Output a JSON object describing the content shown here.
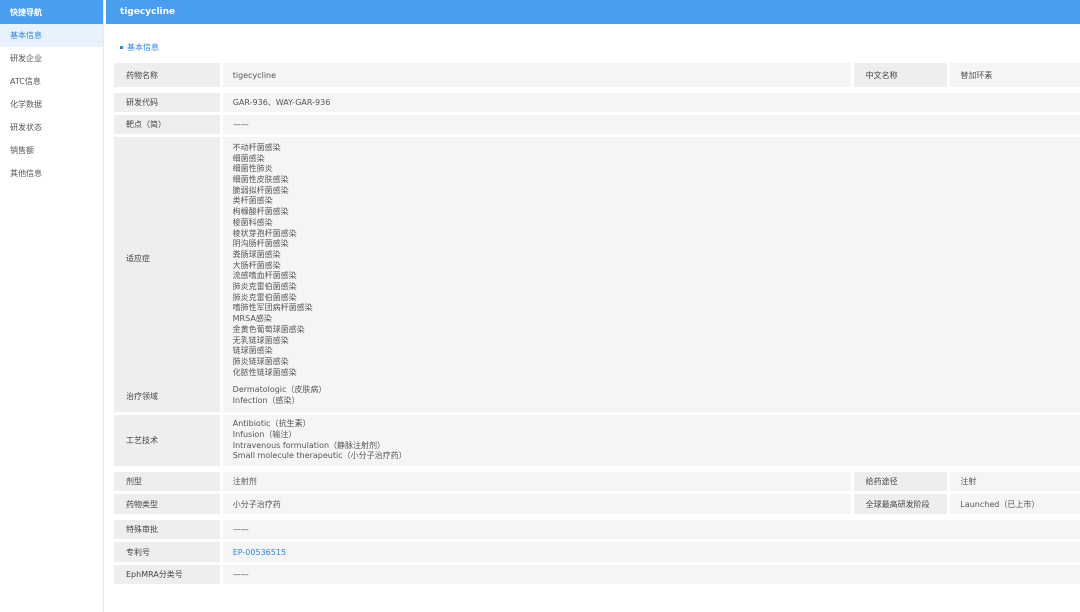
{
  "sidebar": {
    "header": "快捷导航",
    "items": [
      {
        "label": "基本信息",
        "active": true
      },
      {
        "label": "研发企业",
        "active": false
      },
      {
        "label": "ATC信息",
        "active": false
      },
      {
        "label": "化学数据",
        "active": false
      },
      {
        "label": "研发状态",
        "active": false
      },
      {
        "label": "销售额",
        "active": false
      },
      {
        "label": "其他信息",
        "active": false
      }
    ]
  },
  "header": {
    "title": "tigecycline"
  },
  "section": {
    "title": "基本信息"
  },
  "fields": {
    "drug_name": {
      "label": "药物名称",
      "value": "tigecycline"
    },
    "chinese_name": {
      "label": "中文名称",
      "value": "替加环素"
    },
    "rd_code": {
      "label": "研发代码",
      "value": "GAR-936、WAY-GAR-936"
    },
    "target": {
      "label": "靶点（简）",
      "value": "——"
    },
    "indications": {
      "label": "适应症",
      "values": [
        "不动杆菌感染",
        "细菌感染",
        "细菌性肺炎",
        "细菌性皮肤感染",
        "脆弱拟杆菌感染",
        "类杆菌感染",
        "枸橼酸杆菌感染",
        "梭菌科感染",
        "棱状芽孢杆菌感染",
        "阴沟肠杆菌感染",
        "粪肠球菌感染",
        "大肠杆菌感染",
        "流感嗜血杆菌感染",
        "肺炎克雷伯菌感染",
        "肺炎克雷伯菌感染",
        "嗜肺性军团病杆菌感染",
        "MRSA感染",
        "金黄色葡萄球菌感染",
        "无乳链球菌感染",
        "链球菌感染",
        "肺炎链球菌感染",
        "化脓性链球菌感染"
      ]
    },
    "therapeutic_area": {
      "label": "治疗领域",
      "values": [
        "Dermatologic（皮肤病）",
        "Infection（感染）"
      ]
    },
    "technology": {
      "label": "工艺技术",
      "values": [
        "Antibiotic（抗生素）",
        "Infusion（输注）",
        "Intravenous formulation（静脉注射剂）",
        "Small molecule therapeutic（小分子治疗药）"
      ]
    },
    "dosage_form": {
      "label": "剂型",
      "value": "注射剂"
    },
    "route": {
      "label": "给药途径",
      "value": "注射"
    },
    "drug_type": {
      "label": "药物类型",
      "value": "小分子治疗药"
    },
    "highest_phase": {
      "label": "全球最高研发阶段",
      "value": "Launched（已上市）"
    },
    "special_approval": {
      "label": "特殊审批",
      "value": "——"
    },
    "patent": {
      "label": "专利号",
      "value": "EP-00536515"
    },
    "ephmra": {
      "label": "EphMRA分类号",
      "value": "——"
    }
  }
}
